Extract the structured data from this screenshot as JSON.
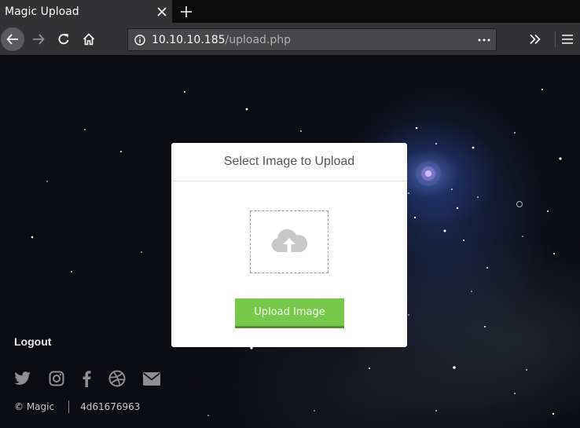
{
  "browser": {
    "tab_title": "Magic Upload",
    "url_host": "10.10.10.185",
    "url_path": "/upload.php",
    "icons": {
      "tab_close": "close-icon",
      "new_tab": "plus-icon",
      "back": "arrow-left-icon",
      "forward": "arrow-right-icon",
      "reload": "reload-icon",
      "home": "home-icon",
      "site_info": "info-icon",
      "page_actions": "ellipsis-icon",
      "overflow": "double-chevron-right-icon",
      "menu": "hamburger-menu-icon"
    }
  },
  "page": {
    "card": {
      "title": "Select Image to Upload",
      "dropzone_icon": "cloud-upload-icon",
      "upload_button": "Upload Image"
    },
    "logout": "Logout",
    "social_icons": [
      "twitter-icon",
      "instagram-icon",
      "facebook-icon",
      "dribbble-icon",
      "envelope-icon"
    ],
    "footer": {
      "copyright": "© Magic",
      "code": "4d61676963"
    },
    "colors": {
      "button_green": "#77c84b",
      "card_background": "#ffffff",
      "toolbar": "#323234"
    }
  }
}
